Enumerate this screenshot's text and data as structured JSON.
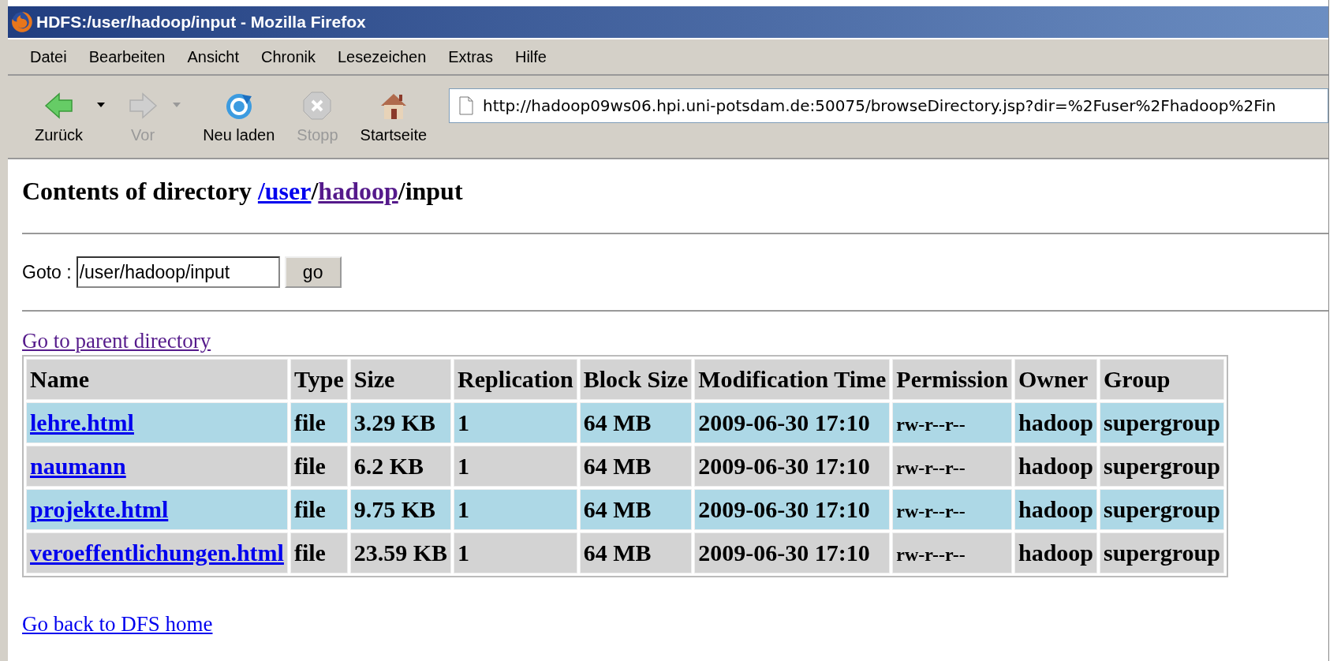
{
  "window": {
    "title": "HDFS:/user/hadoop/input - Mozilla Firefox"
  },
  "menu": [
    "Datei",
    "Bearbeiten",
    "Ansicht",
    "Chronik",
    "Lesezeichen",
    "Extras",
    "Hilfe"
  ],
  "toolbar": [
    {
      "kind": "back",
      "label": "Zurück",
      "disabled": false,
      "dropdown": true
    },
    {
      "kind": "forward",
      "label": "Vor",
      "disabled": true,
      "dropdown": true
    },
    {
      "kind": "reload",
      "label": "Neu laden",
      "disabled": false
    },
    {
      "kind": "stop",
      "label": "Stopp",
      "disabled": true
    },
    {
      "kind": "home",
      "label": "Startseite",
      "disabled": false
    }
  ],
  "address": {
    "value": "http://hadoop09ws06.hpi.uni-potsdam.de:50075/browseDirectory.jsp?dir=%2Fuser%2Fhadoop%2Fin"
  },
  "heading": {
    "text": "Contents of directory",
    "path": [
      {
        "kind": "link",
        "text": "/user",
        "visited": false
      },
      {
        "kind": "text",
        "text": "/"
      },
      {
        "kind": "link",
        "text": "hadoop",
        "visited": true
      },
      {
        "kind": "text",
        "text": "/input"
      }
    ]
  },
  "goto": {
    "label": "Goto :",
    "value": "/user/hadoop/input",
    "button": "go"
  },
  "parent_link": {
    "text": "Go to parent directory",
    "visited": true
  },
  "table": {
    "columns": [
      "Name",
      "Type",
      "Size",
      "Replication",
      "Block Size",
      "Modification Time",
      "Permission",
      "Owner",
      "Group"
    ],
    "rows": [
      {
        "color": "#add8e6",
        "cells": [
          "lehre.html",
          "file",
          "3.29 KB",
          "1",
          "64 MB",
          "2009-06-30 17:10",
          "rw-r--r--",
          "hadoop",
          "supergroup"
        ]
      },
      {
        "color": "#d3d3d3",
        "cells": [
          "naumann",
          "file",
          "6.2 KB",
          "1",
          "64 MB",
          "2009-06-30 17:10",
          "rw-r--r--",
          "hadoop",
          "supergroup"
        ]
      },
      {
        "color": "#add8e6",
        "cells": [
          "projekte.html",
          "file",
          "9.75 KB",
          "1",
          "64 MB",
          "2009-06-30 17:10",
          "rw-r--r--",
          "hadoop",
          "supergroup"
        ]
      },
      {
        "color": "#d3d3d3",
        "cells": [
          "veroeffentlichungen.html",
          "file",
          "23.59 KB",
          "1",
          "64 MB",
          "2009-06-30 17:10",
          "rw-r--r--",
          "hadoop",
          "supergroup"
        ]
      }
    ]
  },
  "home_link": {
    "text": "Go back to DFS home",
    "visited": false
  }
}
